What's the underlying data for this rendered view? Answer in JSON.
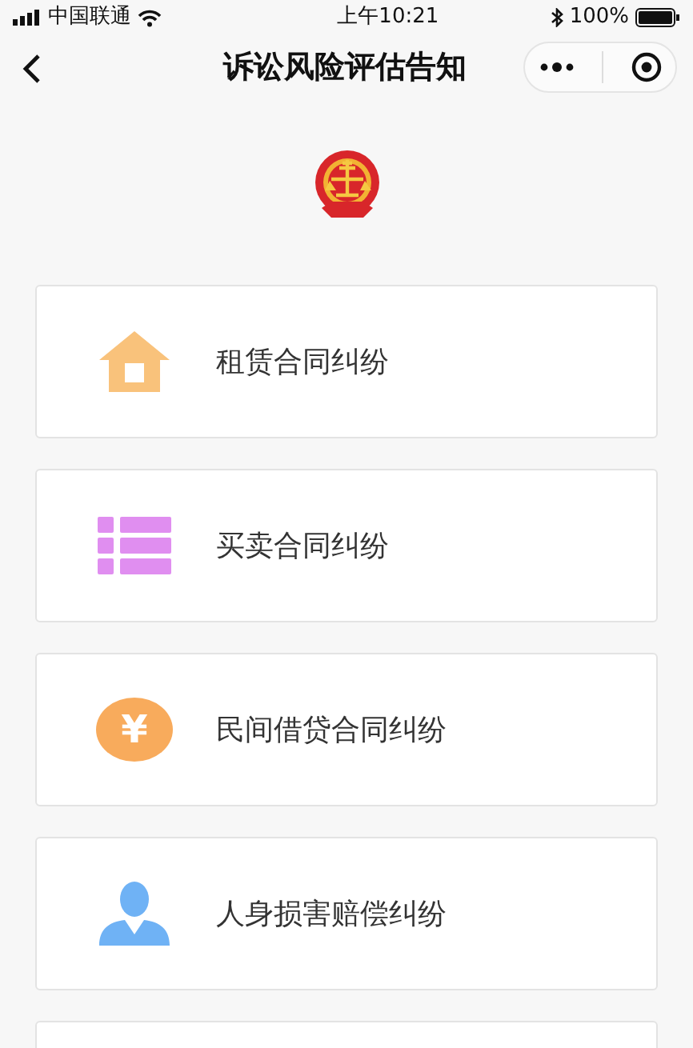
{
  "status_bar": {
    "carrier": "中国联通",
    "time": "上午10:21",
    "battery": "100%"
  },
  "nav_bar": {
    "title": "诉讼风险评估告知"
  },
  "items": [
    {
      "kind": "house",
      "label": "租赁合同纠纷",
      "color": "#f9c27b"
    },
    {
      "kind": "list",
      "label": "买卖合同纠纷",
      "color": "#e08ef0"
    },
    {
      "kind": "coin",
      "label": "民间借贷合同纠纷",
      "color": "#f8ab5c",
      "icon_text": "¥"
    },
    {
      "kind": "person",
      "label": "人身损害赔偿纠纷",
      "color": "#6fb2f5"
    }
  ]
}
